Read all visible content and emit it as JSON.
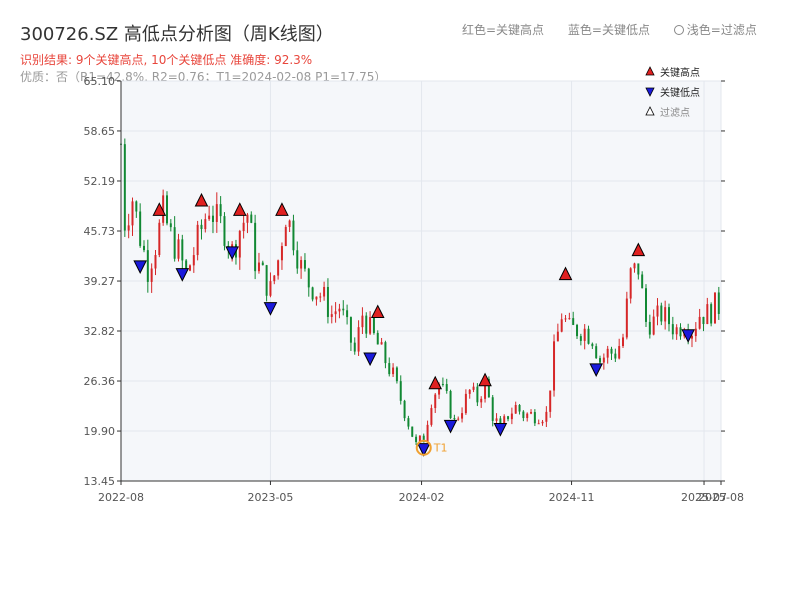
{
  "header": {
    "title": "300726.SZ 高低点分析图（周K线图）",
    "result": "识别结果: 9个关键高点, 10个关键低点   准确度: 92.3%",
    "quality": "优质：否（R1=42.8%, R2=0.76；T1=2024-02-08 P1=17.75）",
    "legend_red": "红色=关键高点",
    "legend_blue": "蓝色=关键低点",
    "legend_light": "浅色=过滤点"
  },
  "colors": {
    "up": "#d62728",
    "down": "#118833",
    "high_marker": "#e02020",
    "low_marker": "#1a1adb",
    "filter_marker": "#ffffff",
    "t1_ring": "#f0a030",
    "plot_bg": "#f5f7fa",
    "grid": "#e3e7ee"
  },
  "chart_data": {
    "type": "candlestick",
    "x_tick_labels": [
      "2022-08",
      "2023-05",
      "2024-02",
      "2024-11",
      "2025-07",
      "2025-08"
    ],
    "x_tick_dates": [
      "2022-08-01",
      "2023-05-01",
      "2024-02-01",
      "2024-11-01",
      "2025-07-01",
      "2025-08-01"
    ],
    "y_tick_labels": [
      "13.45",
      "19.90",
      "26.36",
      "32.82",
      "39.27",
      "45.73",
      "52.19",
      "58.65",
      "65.10"
    ],
    "ylim": [
      13.45,
      65.1
    ],
    "xlim": [
      "2022-08-01",
      "2025-08-01"
    ],
    "legend": [
      {
        "label": "关键高点",
        "symbol": "triangle-up",
        "color": "#e02020"
      },
      {
        "label": "关键低点",
        "symbol": "triangle-down",
        "color": "#1a1adb"
      },
      {
        "label": "过滤点",
        "symbol": "triangle-up",
        "color": "#ffffff"
      }
    ],
    "path": [
      [
        "2022-08-01",
        57
      ],
      [
        "2022-08-08",
        47
      ],
      [
        "2022-08-22",
        50
      ],
      [
        "2022-09-05",
        45
      ],
      [
        "2022-09-19",
        41
      ],
      [
        "2022-10-03",
        44
      ],
      [
        "2022-10-17",
        48
      ],
      [
        "2022-10-31",
        45
      ],
      [
        "2022-11-14",
        43
      ],
      [
        "2022-11-28",
        40
      ],
      [
        "2022-12-12",
        43
      ],
      [
        "2022-12-26",
        46
      ],
      [
        "2023-01-09",
        49
      ],
      [
        "2023-01-23",
        47
      ],
      [
        "2023-02-06",
        46
      ],
      [
        "2023-02-20",
        43
      ],
      [
        "2023-03-06",
        46
      ],
      [
        "2023-03-20",
        48
      ],
      [
        "2023-04-03",
        42
      ],
      [
        "2023-04-17",
        40
      ],
      [
        "2023-05-01",
        38
      ],
      [
        "2023-05-15",
        42
      ],
      [
        "2023-05-29",
        48
      ],
      [
        "2023-06-12",
        45
      ],
      [
        "2023-06-26",
        41
      ],
      [
        "2023-07-10",
        39
      ],
      [
        "2023-07-24",
        38
      ],
      [
        "2023-08-07",
        37
      ],
      [
        "2023-08-21",
        35
      ],
      [
        "2023-09-04",
        36
      ],
      [
        "2023-09-18",
        33
      ],
      [
        "2023-10-02",
        30
      ],
      [
        "2023-10-16",
        35
      ],
      [
        "2023-10-30",
        33
      ],
      [
        "2023-11-13",
        31
      ],
      [
        "2023-11-27",
        29
      ],
      [
        "2023-12-11",
        27
      ],
      [
        "2023-12-25",
        24
      ],
      [
        "2024-01-08",
        21
      ],
      [
        "2024-01-22",
        18
      ],
      [
        "2024-02-05",
        19
      ],
      [
        "2024-02-19",
        24
      ],
      [
        "2024-03-04",
        26
      ],
      [
        "2024-03-18",
        24
      ],
      [
        "2024-04-01",
        21
      ],
      [
        "2024-04-15",
        23
      ],
      [
        "2024-04-29",
        25
      ],
      [
        "2024-05-13",
        24
      ],
      [
        "2024-05-27",
        26
      ],
      [
        "2024-06-10",
        22
      ],
      [
        "2024-06-24",
        20
      ],
      [
        "2024-07-08",
        22
      ],
      [
        "2024-07-22",
        23
      ],
      [
        "2024-08-05",
        22
      ],
      [
        "2024-08-19",
        22
      ],
      [
        "2024-09-02",
        22
      ],
      [
        "2024-09-16",
        22
      ],
      [
        "2024-09-30",
        30
      ],
      [
        "2024-10-14",
        35
      ],
      [
        "2024-10-28",
        33
      ],
      [
        "2024-11-11",
        33
      ],
      [
        "2024-11-25",
        33
      ],
      [
        "2024-12-09",
        32
      ],
      [
        "2024-12-23",
        29
      ],
      [
        "2025-01-06",
        30
      ],
      [
        "2025-01-20",
        30
      ],
      [
        "2025-02-03",
        32
      ],
      [
        "2025-02-17",
        40
      ],
      [
        "2025-03-03",
        41
      ],
      [
        "2025-03-17",
        34
      ],
      [
        "2025-03-31",
        34
      ],
      [
        "2025-04-14",
        35
      ],
      [
        "2025-04-28",
        34
      ],
      [
        "2025-05-12",
        33
      ],
      [
        "2025-05-26",
        34
      ],
      [
        "2025-06-09",
        33
      ],
      [
        "2025-06-23",
        35
      ],
      [
        "2025-07-07",
        35
      ],
      [
        "2025-07-21",
        36
      ],
      [
        "2025-08-01",
        36
      ]
    ],
    "key_highs": [
      {
        "date": "2022-10-10",
        "value": 48.4
      },
      {
        "date": "2022-12-26",
        "value": 49.6
      },
      {
        "date": "2023-03-06",
        "value": 48.4
      },
      {
        "date": "2023-05-22",
        "value": 48.4
      },
      {
        "date": "2023-11-13",
        "value": 35.2
      },
      {
        "date": "2024-02-26",
        "value": 26.0
      },
      {
        "date": "2024-05-27",
        "value": 26.4
      },
      {
        "date": "2024-10-21",
        "value": 40.1
      },
      {
        "date": "2025-03-03",
        "value": 43.2
      }
    ],
    "key_lows": [
      {
        "date": "2022-09-05",
        "value": 41.1
      },
      {
        "date": "2022-11-21",
        "value": 40.1
      },
      {
        "date": "2023-02-20",
        "value": 42.9
      },
      {
        "date": "2023-05-01",
        "value": 35.7
      },
      {
        "date": "2023-10-30",
        "value": 29.2
      },
      {
        "date": "2024-02-05",
        "value": 17.5
      },
      {
        "date": "2024-03-25",
        "value": 20.5
      },
      {
        "date": "2024-06-24",
        "value": 20.1
      },
      {
        "date": "2024-12-16",
        "value": 27.8
      },
      {
        "date": "2025-06-02",
        "value": 32.2
      }
    ],
    "t1": {
      "label": "T1",
      "date": "2024-02-05",
      "value": 17.75
    }
  }
}
